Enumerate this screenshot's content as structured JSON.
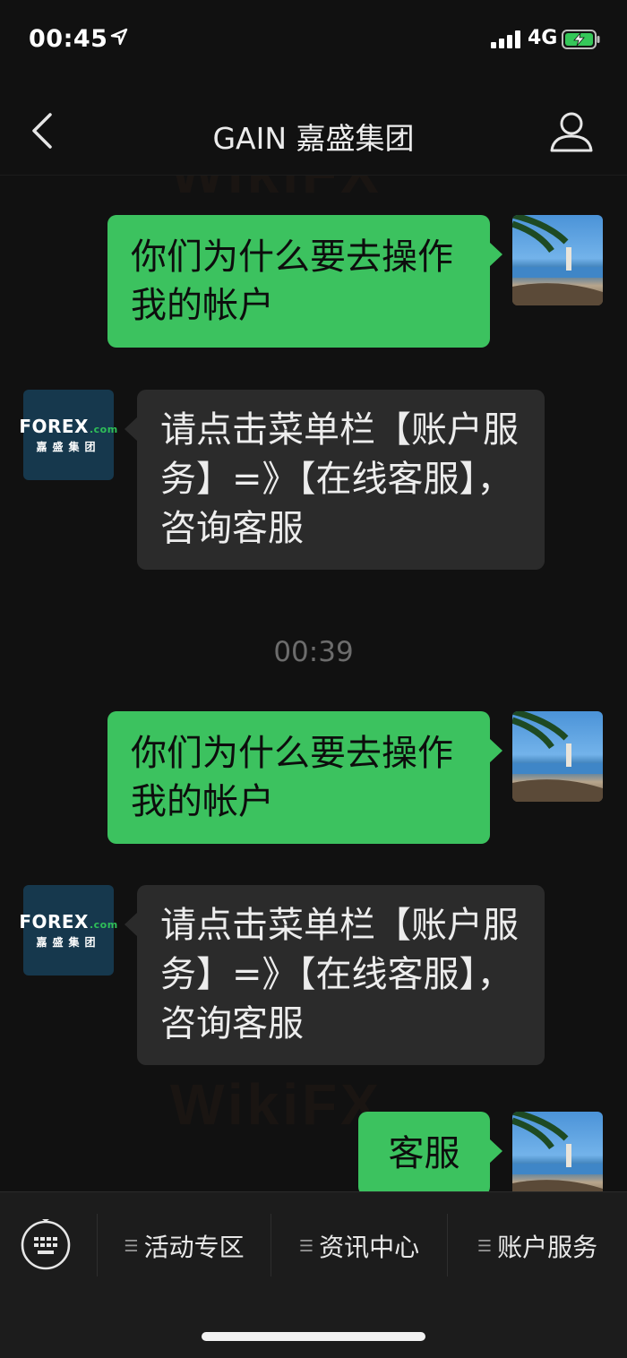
{
  "status_bar": {
    "time": "00:45",
    "network": "4G"
  },
  "nav": {
    "title": "GAIN 嘉盛集团"
  },
  "brand_avatar": {
    "line1_main": "FOREX",
    "line1_suffix": ".com",
    "line2": "嘉盛集团"
  },
  "messages": [
    {
      "type": "sent",
      "text": "你们为什么要去操作我的帐户"
    },
    {
      "type": "received",
      "text": "请点击菜单栏【账户服务】=》【在线客服】，咨询客服"
    },
    {
      "type": "time",
      "text": "00:39"
    },
    {
      "type": "sent",
      "text": "你们为什么要去操作我的帐户"
    },
    {
      "type": "received",
      "text": "请点击菜单栏【账户服务】=》【在线客服】，咨询客服"
    },
    {
      "type": "sent",
      "text": "客服"
    }
  ],
  "watermark": {
    "text": "WikiFX"
  },
  "menu": [
    {
      "label": "活动专区"
    },
    {
      "label": "资讯中心"
    },
    {
      "label": "账户服务"
    }
  ],
  "colors": {
    "sent_bubble": "#3cc25f",
    "received_bubble": "#2b2b2b",
    "background": "#111111"
  }
}
